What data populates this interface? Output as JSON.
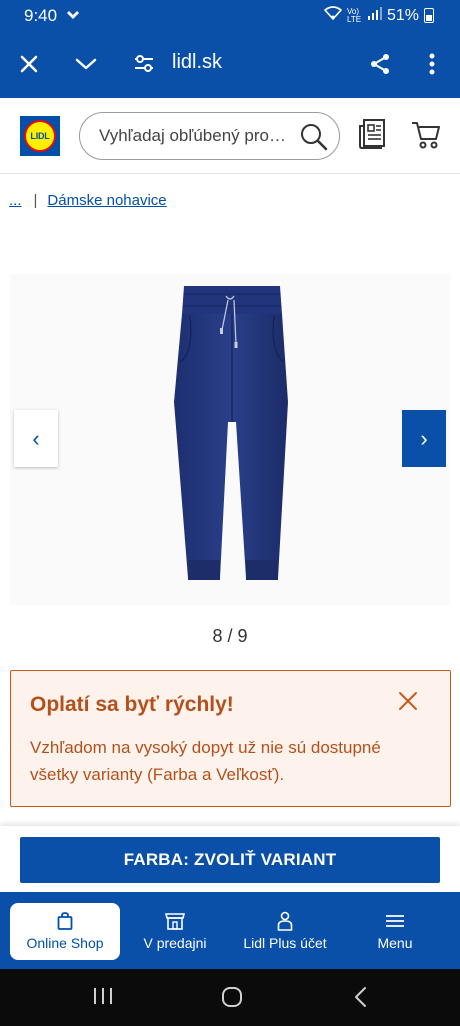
{
  "status_bar": {
    "time": "9:40",
    "battery": "51%",
    "network": "Vo) LTE"
  },
  "browser": {
    "url": "lidl.sk",
    "icons": [
      "close-icon",
      "chevron-down-icon",
      "tune-icon",
      "share-icon",
      "more-vert-icon"
    ]
  },
  "header": {
    "logo_text": "LIDL",
    "search_placeholder": "Vyhľadaj obľúbený produkt",
    "icons": [
      "search-icon",
      "flyer-icon",
      "cart-icon"
    ]
  },
  "breadcrumb": {
    "ellipsis": "...",
    "separator": "|",
    "current": "Dámske nohavice"
  },
  "gallery": {
    "counter": "8 / 9",
    "prev_label": "‹",
    "next_label": "›"
  },
  "alert": {
    "title": "Oplatí sa byť rýchly!",
    "body": "Vzhľadom na vysoký dopyt už nie sú dostupné všetky varianty (Farba a Veľkosť)."
  },
  "variant_button": {
    "label": "FARBA: ZVOLIŤ VARIANT"
  },
  "bottom_nav": {
    "items": [
      {
        "label": "Online Shop",
        "icon": "bag-icon",
        "active": true
      },
      {
        "label": "V predajni",
        "icon": "store-icon",
        "active": false
      },
      {
        "label": "Lidl Plus účet",
        "icon": "user-icon",
        "active": false
      },
      {
        "label": "Menu",
        "icon": "menu-icon",
        "active": false
      }
    ]
  },
  "colors": {
    "brand_blue": "#0a4fa8",
    "alert_orange": "#b5501b",
    "alert_bg": "#fdf3ec"
  }
}
